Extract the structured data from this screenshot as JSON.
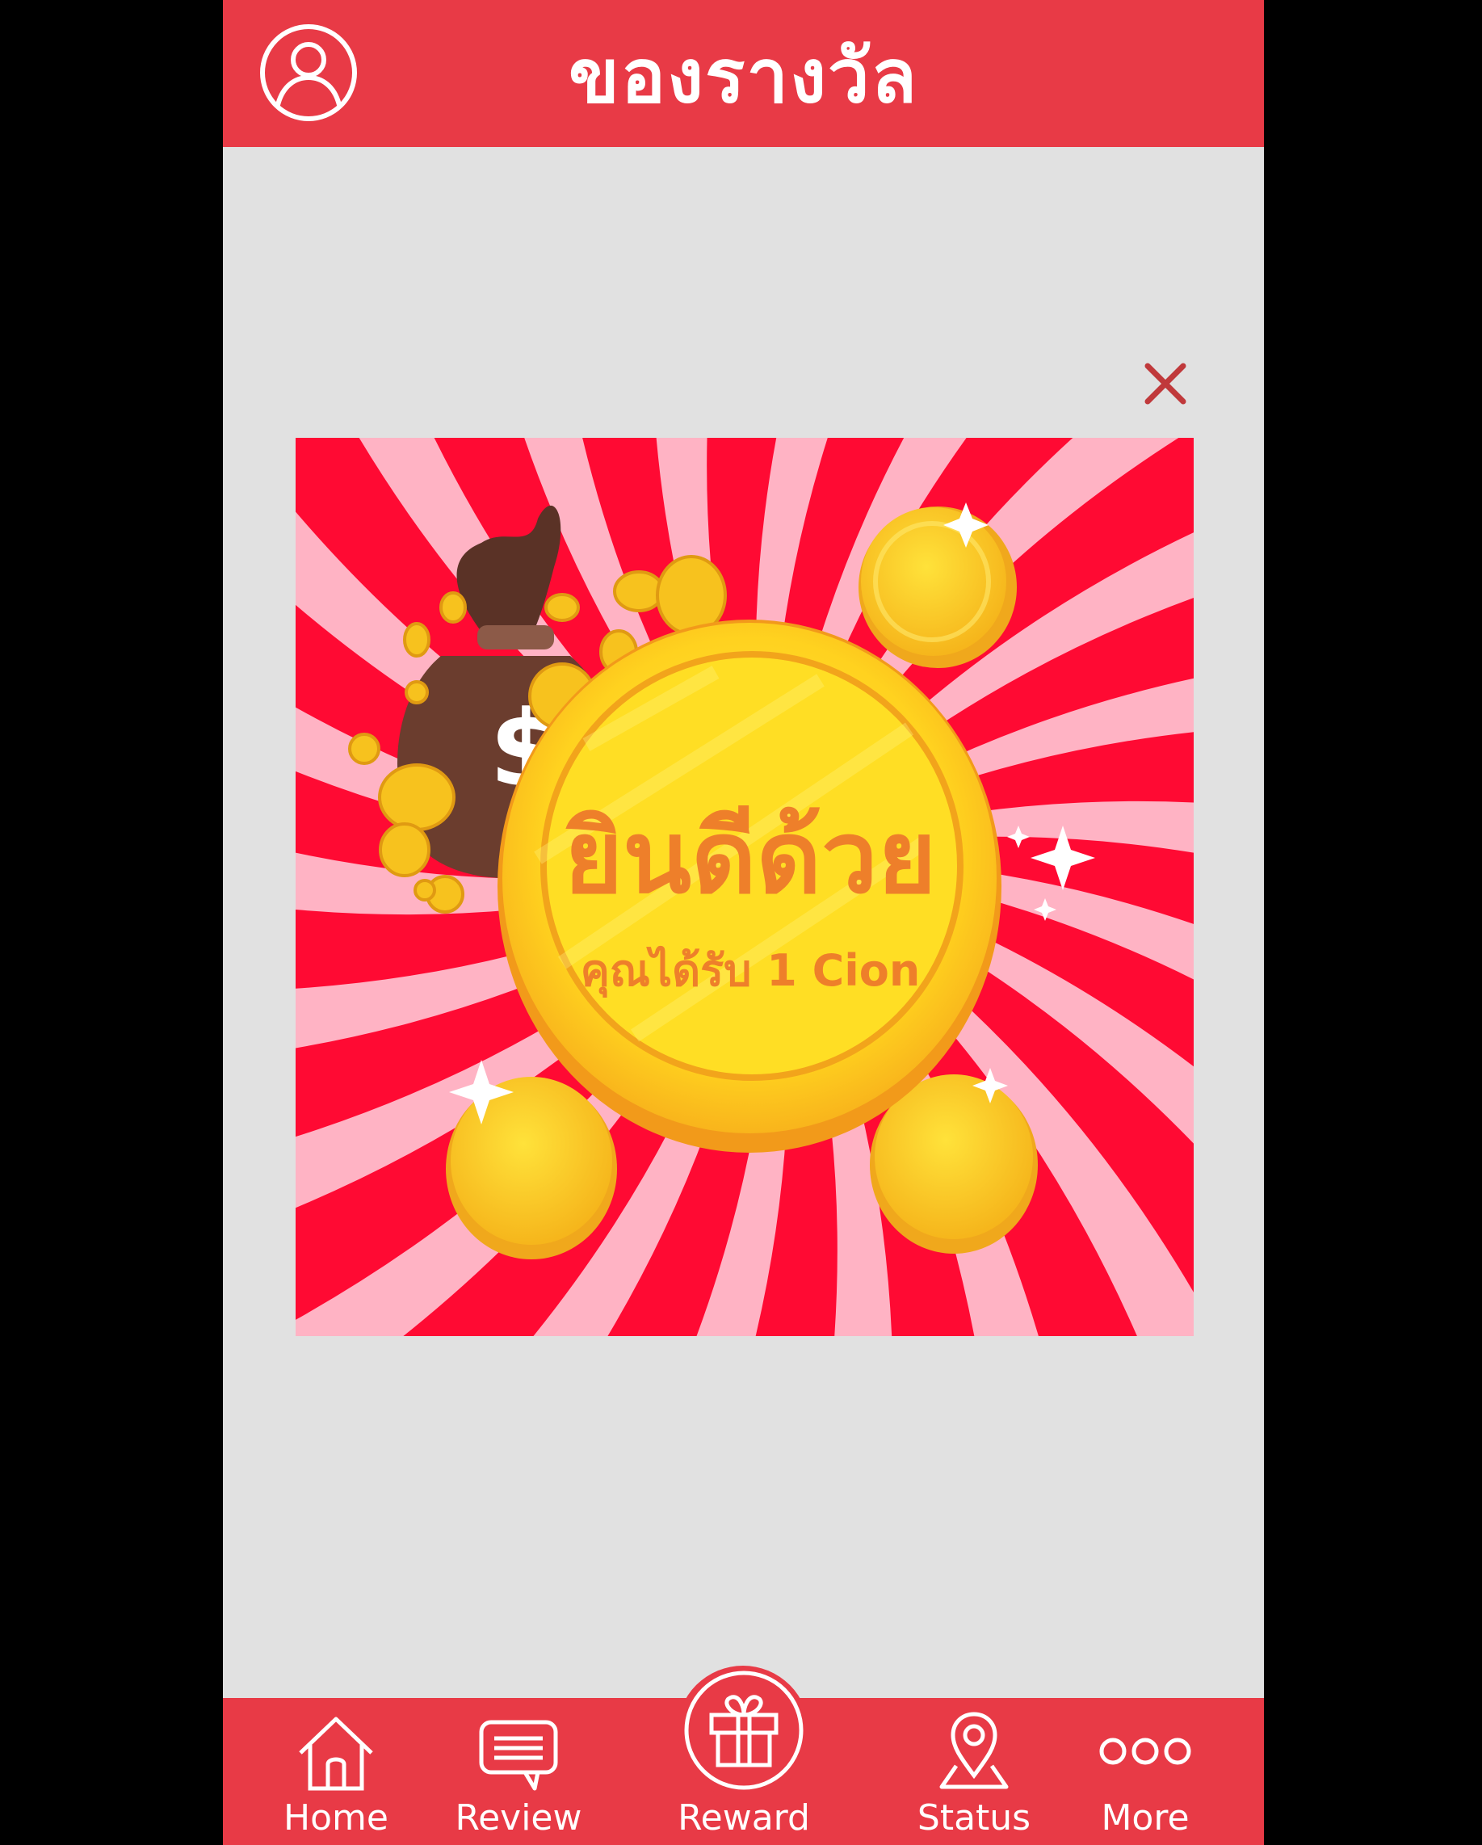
{
  "header": {
    "title": "ของรางวัล",
    "profile_icon": "user-circle-icon"
  },
  "popup": {
    "close_icon": "close-icon",
    "congrats_text": "ยินดีด้วย",
    "received_text": "คุณได้รับ 1 Cion"
  },
  "nav": {
    "items": [
      {
        "label": "Home",
        "icon": "home-icon"
      },
      {
        "label": "Review",
        "icon": "review-icon"
      },
      {
        "label": "Reward",
        "icon": "gift-icon",
        "active": true
      },
      {
        "label": "Status",
        "icon": "location-pin-icon"
      },
      {
        "label": "More",
        "icon": "more-dots-icon"
      }
    ]
  },
  "colors": {
    "brand": "#e83a46",
    "background": "#e1e1e1",
    "close": "#c0393b",
    "burst_red": "#ff0a33",
    "burst_pink": "#ffb3c4",
    "coin_gold": "#ffd21f",
    "text_orange": "#ee7f2a"
  }
}
